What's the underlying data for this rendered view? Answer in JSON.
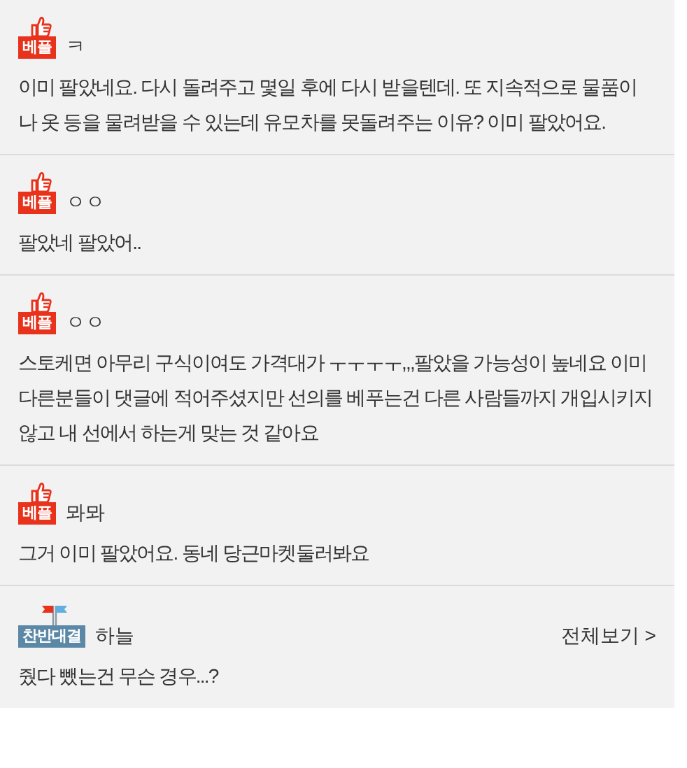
{
  "comments": [
    {
      "kind": "best",
      "badge": "베플",
      "author": "ㅋ",
      "text": "이미 팔았네요. 다시 돌려주고 몇일 후에 다시 받을텐데. 또 지속적으로 물품이 나 옷 등을 물려받을 수 있는데 유모차를 못돌려주는 이유? 이미 팔았어요."
    },
    {
      "kind": "best",
      "badge": "베플",
      "author": "ㅇㅇ",
      "text": "팔았네 팔았어.."
    },
    {
      "kind": "best",
      "badge": "베플",
      "author": "ㅇㅇ",
      "text": "스토케면 아무리 구식이여도 가격대가 ㅜㅜㅜㅜ,,,팔았을 가능성이 높네요 이미 다른분들이 댓글에 적어주셨지만 선의를 베푸는건 다른 사람들까지 개입시키지 않고 내 선에서 하는게 맞는 것 같아요"
    },
    {
      "kind": "best",
      "badge": "베플",
      "author": "뫄뫄",
      "text": "그거 이미 팔았어요. 동네 당근마켓둘러봐요"
    },
    {
      "kind": "debate",
      "badge": "찬반대결",
      "author": "하늘",
      "link": "전체보기 >",
      "text": "줬다 뺐는건 무슨 경우...?"
    }
  ]
}
